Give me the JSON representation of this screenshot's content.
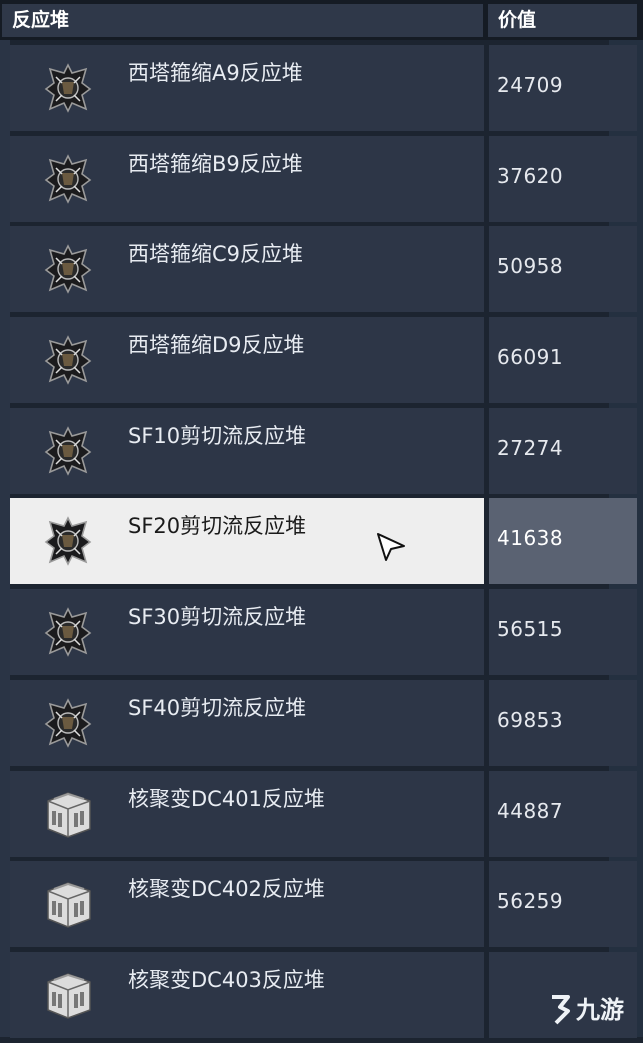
{
  "header": {
    "name_label": "反应堆",
    "value_label": "价值"
  },
  "rows": [
    {
      "name": "西塔箍缩A9反应堆",
      "value": "24709",
      "icon": "reactor-dark-icon"
    },
    {
      "name": "西塔箍缩B9反应堆",
      "value": "37620",
      "icon": "reactor-dark-icon"
    },
    {
      "name": "西塔箍缩C9反应堆",
      "value": "50958",
      "icon": "reactor-dark-icon"
    },
    {
      "name": "西塔箍缩D9反应堆",
      "value": "66091",
      "icon": "reactor-dark-icon"
    },
    {
      "name": "SF10剪切流反应堆",
      "value": "27274",
      "icon": "reactor-dark-icon"
    },
    {
      "name": "SF20剪切流反应堆",
      "value": "41638",
      "icon": "reactor-dark-icon",
      "selected": true
    },
    {
      "name": "SF30剪切流反应堆",
      "value": "56515",
      "icon": "reactor-dark-icon"
    },
    {
      "name": "SF40剪切流反应堆",
      "value": "69853",
      "icon": "reactor-dark-icon"
    },
    {
      "name": "核聚变DC401反应堆",
      "value": "44887",
      "icon": "reactor-white-icon"
    },
    {
      "name": "核聚变DC402反应堆",
      "value": "56259",
      "icon": "reactor-white-icon"
    },
    {
      "name": "核聚变DC403反应堆",
      "value": "",
      "icon": "reactor-white-icon"
    }
  ],
  "watermark": {
    "text": "九游"
  },
  "colors": {
    "cell": "#2d3647",
    "header": "#2f3849",
    "selected": "#eeeeee",
    "selected_value": "#5a6272"
  }
}
